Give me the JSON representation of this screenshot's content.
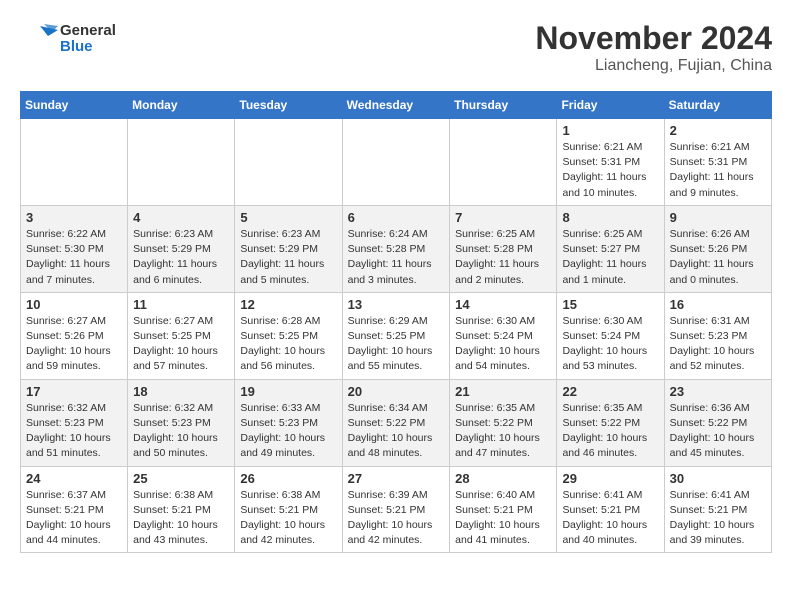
{
  "header": {
    "logo_line1": "General",
    "logo_line2": "Blue",
    "month": "November 2024",
    "location": "Liancheng, Fujian, China"
  },
  "weekdays": [
    "Sunday",
    "Monday",
    "Tuesday",
    "Wednesday",
    "Thursday",
    "Friday",
    "Saturday"
  ],
  "weeks": [
    [
      {
        "day": "",
        "info": ""
      },
      {
        "day": "",
        "info": ""
      },
      {
        "day": "",
        "info": ""
      },
      {
        "day": "",
        "info": ""
      },
      {
        "day": "",
        "info": ""
      },
      {
        "day": "1",
        "info": "Sunrise: 6:21 AM\nSunset: 5:31 PM\nDaylight: 11 hours\nand 10 minutes."
      },
      {
        "day": "2",
        "info": "Sunrise: 6:21 AM\nSunset: 5:31 PM\nDaylight: 11 hours\nand 9 minutes."
      }
    ],
    [
      {
        "day": "3",
        "info": "Sunrise: 6:22 AM\nSunset: 5:30 PM\nDaylight: 11 hours\nand 7 minutes."
      },
      {
        "day": "4",
        "info": "Sunrise: 6:23 AM\nSunset: 5:29 PM\nDaylight: 11 hours\nand 6 minutes."
      },
      {
        "day": "5",
        "info": "Sunrise: 6:23 AM\nSunset: 5:29 PM\nDaylight: 11 hours\nand 5 minutes."
      },
      {
        "day": "6",
        "info": "Sunrise: 6:24 AM\nSunset: 5:28 PM\nDaylight: 11 hours\nand 3 minutes."
      },
      {
        "day": "7",
        "info": "Sunrise: 6:25 AM\nSunset: 5:28 PM\nDaylight: 11 hours\nand 2 minutes."
      },
      {
        "day": "8",
        "info": "Sunrise: 6:25 AM\nSunset: 5:27 PM\nDaylight: 11 hours\nand 1 minute."
      },
      {
        "day": "9",
        "info": "Sunrise: 6:26 AM\nSunset: 5:26 PM\nDaylight: 11 hours\nand 0 minutes."
      }
    ],
    [
      {
        "day": "10",
        "info": "Sunrise: 6:27 AM\nSunset: 5:26 PM\nDaylight: 10 hours\nand 59 minutes."
      },
      {
        "day": "11",
        "info": "Sunrise: 6:27 AM\nSunset: 5:25 PM\nDaylight: 10 hours\nand 57 minutes."
      },
      {
        "day": "12",
        "info": "Sunrise: 6:28 AM\nSunset: 5:25 PM\nDaylight: 10 hours\nand 56 minutes."
      },
      {
        "day": "13",
        "info": "Sunrise: 6:29 AM\nSunset: 5:25 PM\nDaylight: 10 hours\nand 55 minutes."
      },
      {
        "day": "14",
        "info": "Sunrise: 6:30 AM\nSunset: 5:24 PM\nDaylight: 10 hours\nand 54 minutes."
      },
      {
        "day": "15",
        "info": "Sunrise: 6:30 AM\nSunset: 5:24 PM\nDaylight: 10 hours\nand 53 minutes."
      },
      {
        "day": "16",
        "info": "Sunrise: 6:31 AM\nSunset: 5:23 PM\nDaylight: 10 hours\nand 52 minutes."
      }
    ],
    [
      {
        "day": "17",
        "info": "Sunrise: 6:32 AM\nSunset: 5:23 PM\nDaylight: 10 hours\nand 51 minutes."
      },
      {
        "day": "18",
        "info": "Sunrise: 6:32 AM\nSunset: 5:23 PM\nDaylight: 10 hours\nand 50 minutes."
      },
      {
        "day": "19",
        "info": "Sunrise: 6:33 AM\nSunset: 5:23 PM\nDaylight: 10 hours\nand 49 minutes."
      },
      {
        "day": "20",
        "info": "Sunrise: 6:34 AM\nSunset: 5:22 PM\nDaylight: 10 hours\nand 48 minutes."
      },
      {
        "day": "21",
        "info": "Sunrise: 6:35 AM\nSunset: 5:22 PM\nDaylight: 10 hours\nand 47 minutes."
      },
      {
        "day": "22",
        "info": "Sunrise: 6:35 AM\nSunset: 5:22 PM\nDaylight: 10 hours\nand 46 minutes."
      },
      {
        "day": "23",
        "info": "Sunrise: 6:36 AM\nSunset: 5:22 PM\nDaylight: 10 hours\nand 45 minutes."
      }
    ],
    [
      {
        "day": "24",
        "info": "Sunrise: 6:37 AM\nSunset: 5:21 PM\nDaylight: 10 hours\nand 44 minutes."
      },
      {
        "day": "25",
        "info": "Sunrise: 6:38 AM\nSunset: 5:21 PM\nDaylight: 10 hours\nand 43 minutes."
      },
      {
        "day": "26",
        "info": "Sunrise: 6:38 AM\nSunset: 5:21 PM\nDaylight: 10 hours\nand 42 minutes."
      },
      {
        "day": "27",
        "info": "Sunrise: 6:39 AM\nSunset: 5:21 PM\nDaylight: 10 hours\nand 42 minutes."
      },
      {
        "day": "28",
        "info": "Sunrise: 6:40 AM\nSunset: 5:21 PM\nDaylight: 10 hours\nand 41 minutes."
      },
      {
        "day": "29",
        "info": "Sunrise: 6:41 AM\nSunset: 5:21 PM\nDaylight: 10 hours\nand 40 minutes."
      },
      {
        "day": "30",
        "info": "Sunrise: 6:41 AM\nSunset: 5:21 PM\nDaylight: 10 hours\nand 39 minutes."
      }
    ]
  ]
}
